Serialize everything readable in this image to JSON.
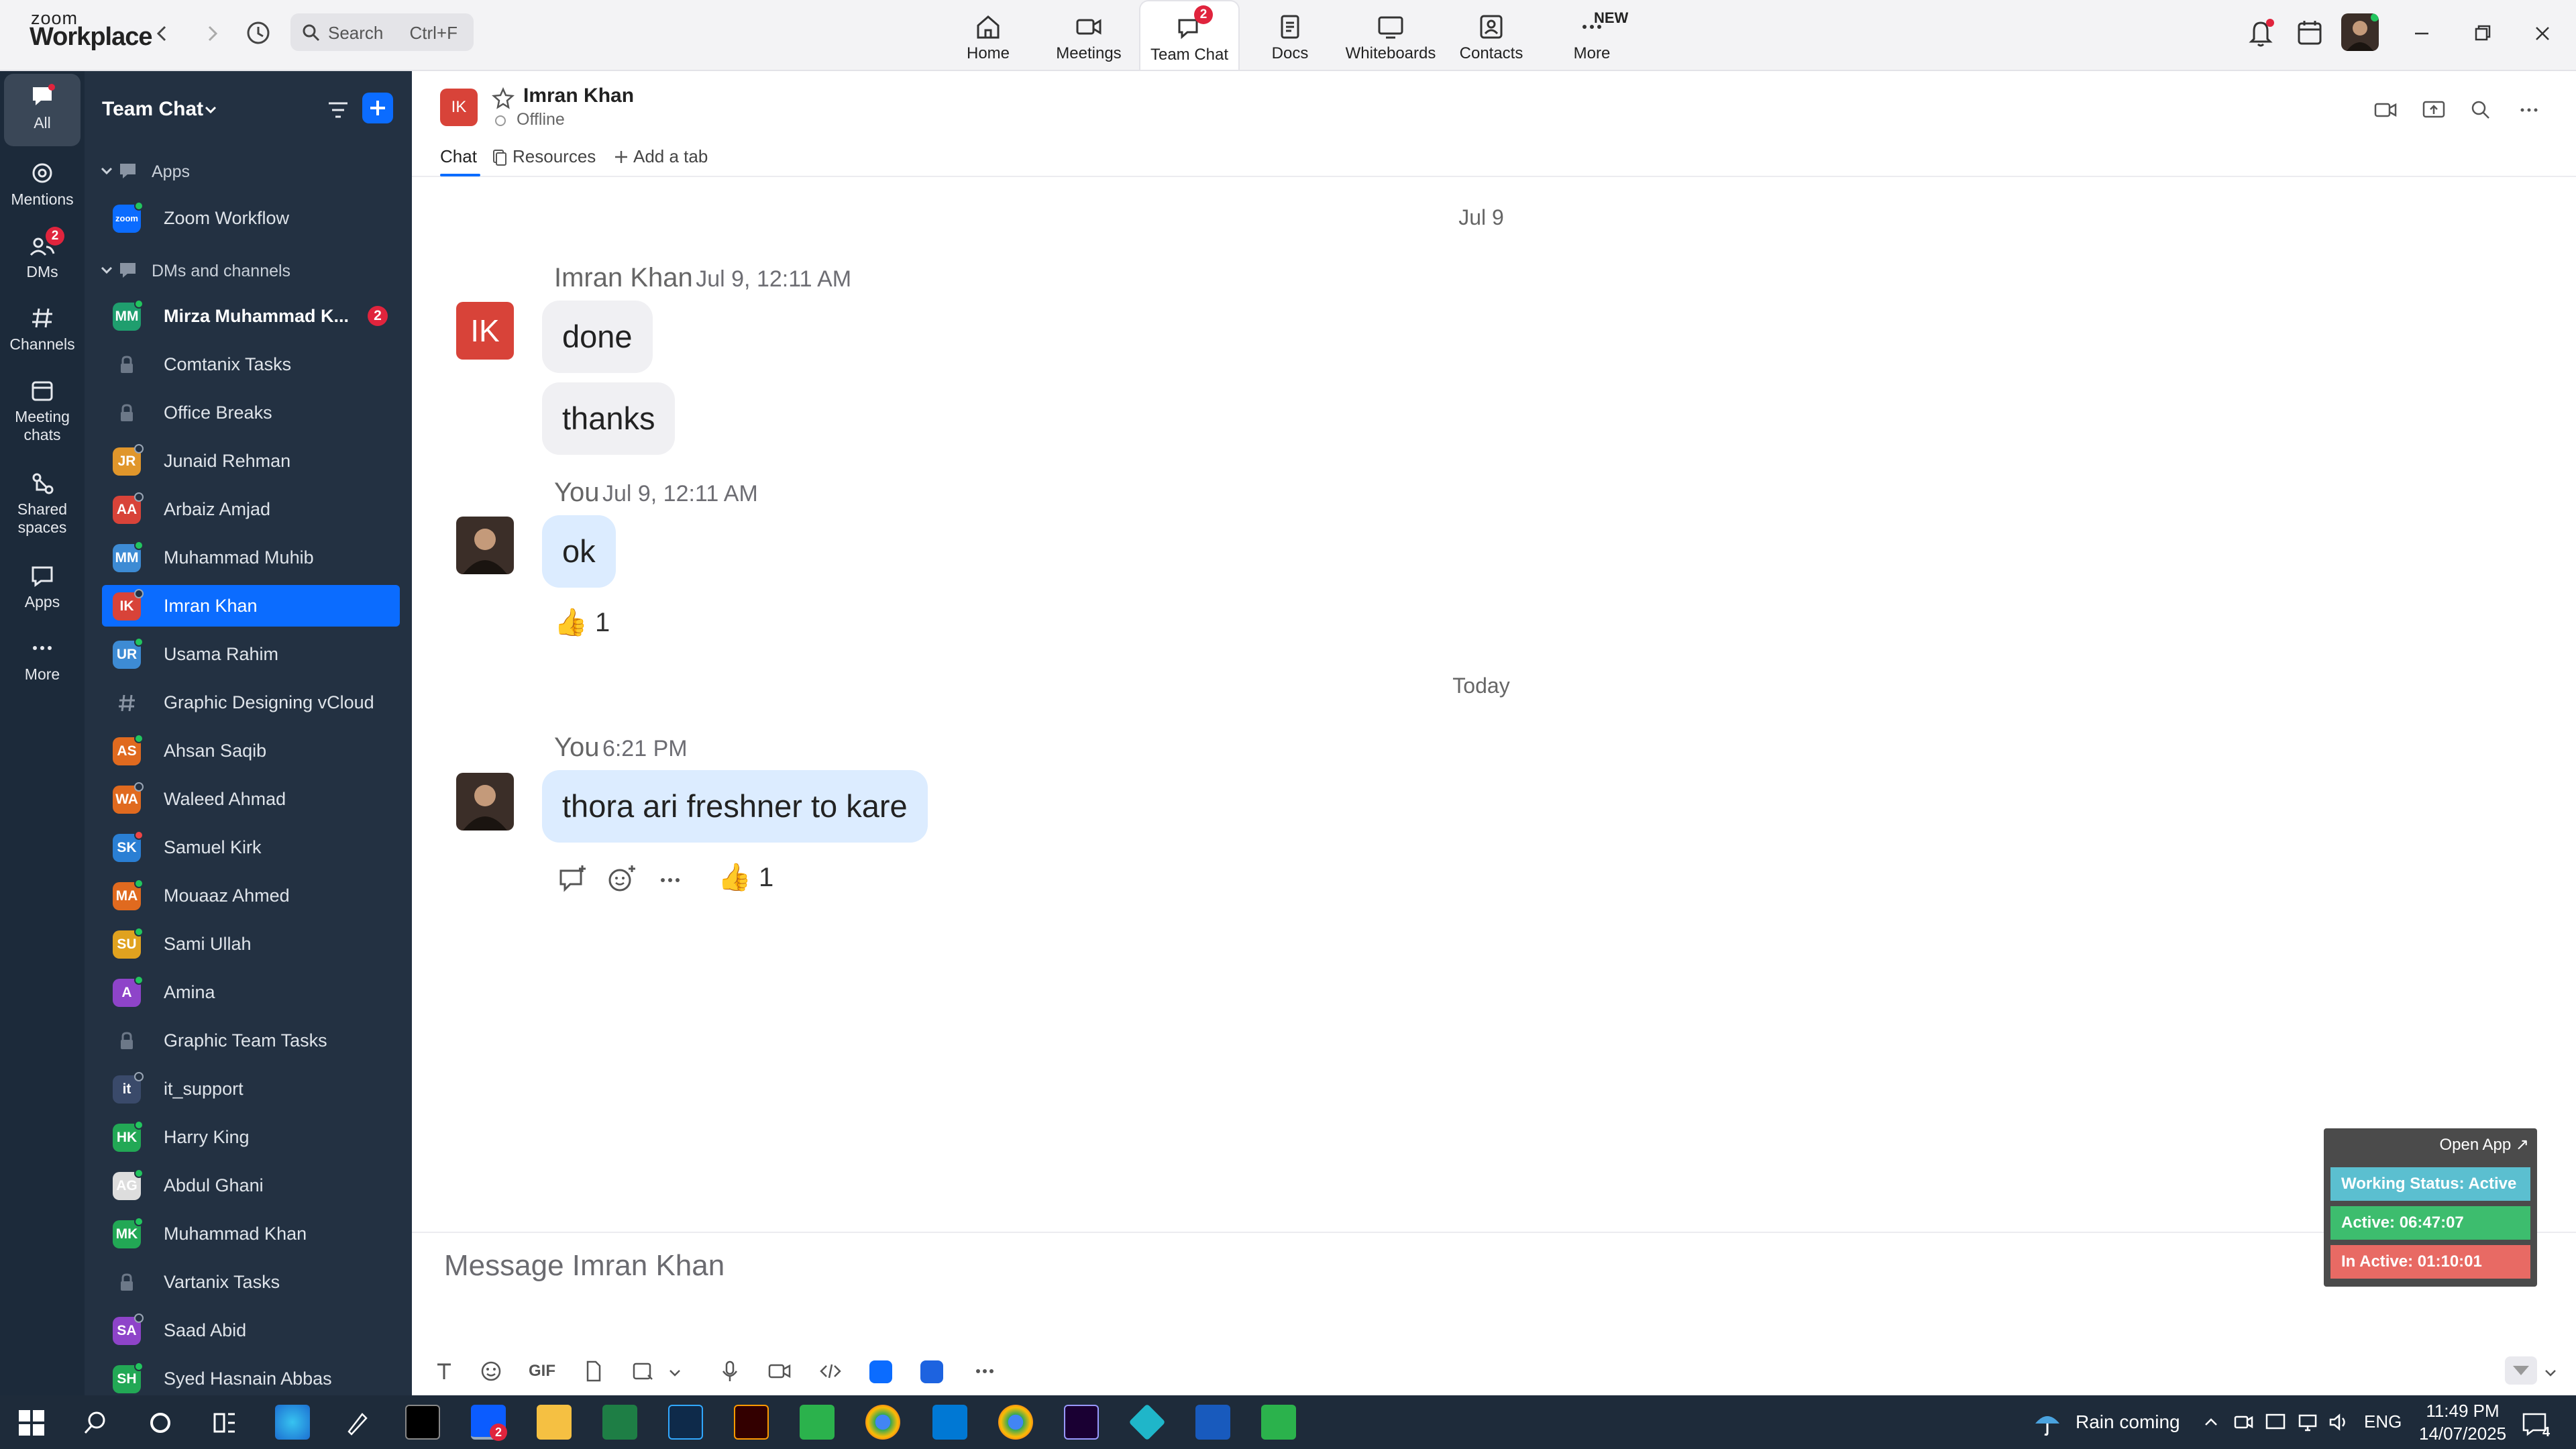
{
  "app": {
    "logo_small": "zoom",
    "logo_big": "Workplace"
  },
  "search": {
    "placeholder": "Search",
    "hint": "Ctrl+F"
  },
  "nav": {
    "tabs": [
      {
        "label": "Home",
        "icon": "home-icon"
      },
      {
        "label": "Meetings",
        "icon": "video-icon"
      },
      {
        "label": "Team Chat",
        "icon": "chat-icon",
        "badge": "2"
      },
      {
        "label": "Docs",
        "icon": "doc-icon"
      },
      {
        "label": "Whiteboards",
        "icon": "whiteboard-icon"
      },
      {
        "label": "Contacts",
        "icon": "contacts-icon"
      },
      {
        "label": "More",
        "icon": "more-icon",
        "tag": "NEW"
      }
    ]
  },
  "rail": {
    "items": [
      {
        "label": "All"
      },
      {
        "label": "Mentions"
      },
      {
        "label": "DMs",
        "badge": "2"
      },
      {
        "label": "Channels"
      },
      {
        "label": "Meeting chats"
      },
      {
        "label": "Shared spaces"
      },
      {
        "label": "Apps"
      },
      {
        "label": "More"
      }
    ]
  },
  "sidebar": {
    "title": "Team Chat",
    "section_apps": "Apps",
    "app_item": {
      "name": "Zoom Workflow",
      "avatar": "zoom"
    },
    "section_dms": "DMs and channels",
    "items": [
      {
        "name": "Mirza Muhammad K...",
        "initials": "MM",
        "color": "#1f9e6e",
        "badge": "2",
        "bold": true,
        "dot": "g"
      },
      {
        "name": "Comtanix Tasks",
        "type": "lock"
      },
      {
        "name": "Office Breaks",
        "type": "lock"
      },
      {
        "name": "Junaid Rehman",
        "initials": "JR",
        "color": "#e0962b",
        "dot": "o"
      },
      {
        "name": "Arbaiz Amjad",
        "initials": "AA",
        "color": "#d84339",
        "dot": "o"
      },
      {
        "name": "Muhammad Muhib",
        "initials": "MM",
        "color": "#3d8bd4",
        "dot": "g"
      },
      {
        "name": "Imran Khan",
        "initials": "IK",
        "color": "#d84339",
        "dot": "o",
        "active": true
      },
      {
        "name": "Usama Rahim",
        "initials": "UR",
        "color": "#3d8bd4",
        "dot": "g"
      },
      {
        "name": "Graphic Designing vCloud",
        "type": "hash"
      },
      {
        "name": "Ahsan Saqib",
        "initials": "AS",
        "color": "#e06a1f",
        "dot": "g"
      },
      {
        "name": "Waleed Ahmad",
        "initials": "WA",
        "color": "#e06a1f",
        "dot": "o"
      },
      {
        "name": "Samuel Kirk",
        "initials": "SK",
        "color": "#2a7fd4",
        "dot": "r"
      },
      {
        "name": "Mouaaz Ahmed",
        "initials": "MA",
        "color": "#e06a1f",
        "dot": "g"
      },
      {
        "name": "Sami Ullah",
        "initials": "SU",
        "color": "#e0a21f",
        "dot": "g"
      },
      {
        "name": "Amina",
        "initials": "A",
        "color": "#8e44c9",
        "dot": "g"
      },
      {
        "name": "Graphic Team Tasks",
        "type": "lock"
      },
      {
        "name": "it_support",
        "initials": "it",
        "color": "#3a4a6a",
        "dot": "o"
      },
      {
        "name": "Harry King",
        "initials": "HK",
        "color": "#22a855",
        "dot": "g"
      },
      {
        "name": "Abdul Ghani",
        "initials": "AG",
        "color": "#dddddd",
        "dot": "g"
      },
      {
        "name": "Muhammad Khan",
        "initials": "MK",
        "color": "#22a855",
        "dot": "g"
      },
      {
        "name": "Vartanix Tasks",
        "type": "lock"
      },
      {
        "name": "Saad Abid",
        "initials": "SA",
        "color": "#8e44c9",
        "dot": "o"
      },
      {
        "name": "Syed Hasnain Abbas",
        "initials": "SH",
        "color": "#22a855",
        "dot": "g"
      }
    ]
  },
  "chat": {
    "name": "Imran Khan",
    "initials": "IK",
    "status": "Offline",
    "tabs": [
      "Chat",
      "Resources",
      "Add a tab"
    ],
    "date1": "Jul 9",
    "date2": "Today",
    "groups": [
      {
        "sender": "Imran Khan",
        "time": "Jul 9, 12:11 AM",
        "messages": [
          "done",
          "thanks"
        ]
      },
      {
        "sender": "You",
        "time": "Jul 9, 12:11 AM",
        "messages": [
          "ok"
        ],
        "reaction": "1"
      },
      {
        "sender": "You",
        "time": "6:21 PM",
        "messages": [
          "thora ari freshner to kare"
        ],
        "reaction": "1"
      }
    ]
  },
  "composer": {
    "placeholder": "Message Imran Khan",
    "gif": "GIF"
  },
  "widget": {
    "open": "Open App ↗",
    "working": "Working Status: Active",
    "active": "Active: 06:47:07",
    "inactive": "In Active: 01:10:01",
    "colors": {
      "working": "#5bbfd0",
      "active": "#3dbd6e",
      "inactive": "#e86a64"
    }
  },
  "taskbar": {
    "weather": "Rain coming",
    "lang": "ENG",
    "time": "11:49 PM",
    "date": "14/07/2025",
    "notif": "4",
    "zoom_badge": "2"
  },
  "colors": {
    "accent": "#0b6cff",
    "sidebar": "#233142",
    "rail": "#1c2a3a"
  }
}
